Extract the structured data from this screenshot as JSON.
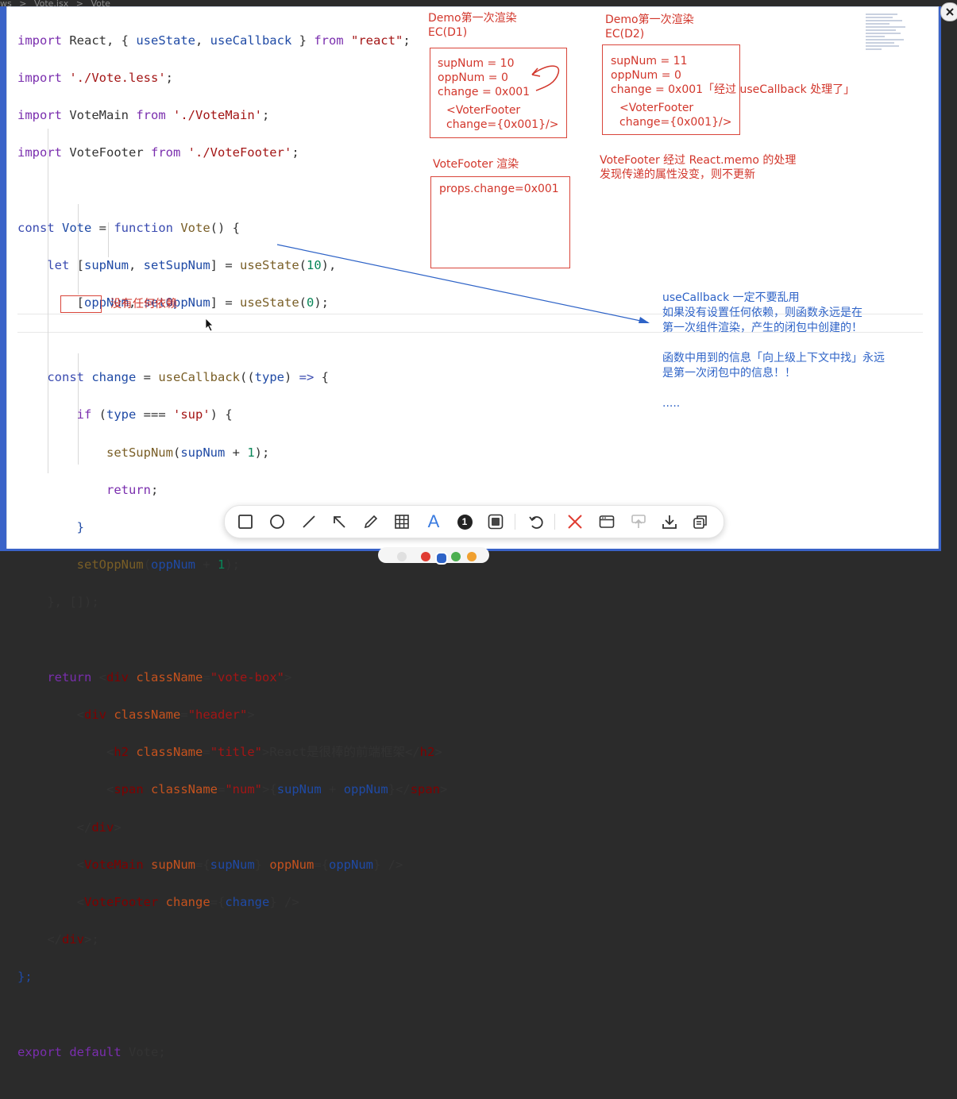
{
  "breadcrumb": {
    "part1": "ws",
    "sep1": ">",
    "part2": "Vote.jsx",
    "sep2": ">",
    "part3": "Vote"
  },
  "code": {
    "l1": [
      "import",
      " React, { ",
      "useState",
      ", ",
      "useCallback",
      " } ",
      "from",
      " ",
      "\"react\"",
      ";"
    ],
    "l2": [
      "import",
      " ",
      "'./Vote.less'",
      ";"
    ],
    "l3": [
      "import",
      " VoteMain ",
      "from",
      " ",
      "'./VoteMain'",
      ";"
    ],
    "l4": [
      "import",
      " VoteFooter ",
      "from",
      " ",
      "'./VoteFooter'",
      ";"
    ],
    "l6": [
      "const",
      " ",
      "Vote",
      " = ",
      "function",
      " ",
      "Vote",
      "() {"
    ],
    "l7": [
      "let",
      " [",
      "supNum",
      ", ",
      "setSupNum",
      "] = ",
      "useState",
      "(",
      "10",
      "),"
    ],
    "l8": [
      "[",
      "oppNum",
      ", ",
      "setOppNum",
      "] = ",
      "useState",
      "(",
      "0",
      ");"
    ],
    "l10": [
      "const",
      " ",
      "change",
      " = ",
      "useCallback",
      "((",
      "type",
      ") ",
      "=>",
      " {"
    ],
    "l11": [
      "if",
      " (",
      "type",
      " === ",
      "'sup'",
      ") {"
    ],
    "l12": [
      "setSupNum",
      "(",
      "supNum",
      " + ",
      "1",
      ");"
    ],
    "l13": [
      "return",
      ";"
    ],
    "l14": [
      "}"
    ],
    "l15": [
      "setOppNum",
      "(",
      "oppNum",
      " + ",
      "1",
      ");"
    ],
    "l16": [
      "},",
      " []);"
    ],
    "l18": [
      "return",
      " <",
      "div",
      " ",
      "className",
      "=",
      "\"vote-box\"",
      ">"
    ],
    "l19": [
      "<",
      "div",
      " ",
      "className",
      "=",
      "\"header\"",
      ">"
    ],
    "l20": [
      "<",
      "h2",
      " ",
      "className",
      "=",
      "\"title\"",
      ">React是很棒的前端框架</",
      "h2",
      ">"
    ],
    "l21": [
      "<",
      "span",
      " ",
      "className",
      "=",
      "\"num\"",
      ">{",
      "supNum",
      " + ",
      "oppNum",
      "}</",
      "span",
      ">"
    ],
    "l22": [
      "</",
      "div",
      ">"
    ],
    "l23": [
      "<",
      "VoteMain",
      " ",
      "supNum",
      "={",
      "supNum",
      "} ",
      "oppNum",
      "={",
      "oppNum",
      "} />"
    ],
    "l24": [
      "<",
      "VoteFooter",
      " ",
      "change",
      "={",
      "change",
      "} />"
    ],
    "l25": [
      "</",
      "div",
      ">;"
    ],
    "l26": [
      "};"
    ],
    "l28": [
      "export",
      " ",
      "default",
      " Vote;"
    ]
  },
  "annotations": {
    "no_deps": "没有任何依赖",
    "d1_title": "Demo第一次渲染\nEC(D1)",
    "d1_body": "supNum = 10\noppNum = 0\nchange = 0x001",
    "d1_footer": "<VoterFooter\nchange={0x001}/>",
    "d2_title": "Demo第一次渲染\nEC(D2)",
    "d2_body": "supNum = 11\noppNum = 0\nchange = 0x001「经过 useCallback 处理了」",
    "d2_footer": "<VoterFooter\nchange={0x001}/>",
    "vf_title": "VoteFooter 渲染",
    "vf_body": "props.change=0x001",
    "memo_note": "VoteFooter 经过 React.memo 的处理\n发现传递的属性没变，则不更新",
    "blue_note": "useCallback 一定不要乱用\n如果没有设置任何依赖，则函数永远是在\n第一次组件渲染，产生的闭包中创建的！\n\n函数中用到的信息「向上级上下文中找」永远\n是第一次闭包中的信息！！\n\n....."
  },
  "toolbar": {
    "tools": [
      "rectangle-tool",
      "ellipse-tool",
      "line-tool",
      "arrow-tool",
      "pen-tool",
      "mosaic-tool",
      "text-tool",
      "number-tool",
      "highlight-tool",
      "undo",
      "delete",
      "screenshot",
      "pin",
      "download",
      "copy"
    ],
    "text_glyph": "A",
    "number_glyph": "1"
  },
  "colors": {
    "annotation_red": "#d2362b",
    "annotation_blue": "#2e63c7",
    "frame_blue": "#3a63c8"
  }
}
